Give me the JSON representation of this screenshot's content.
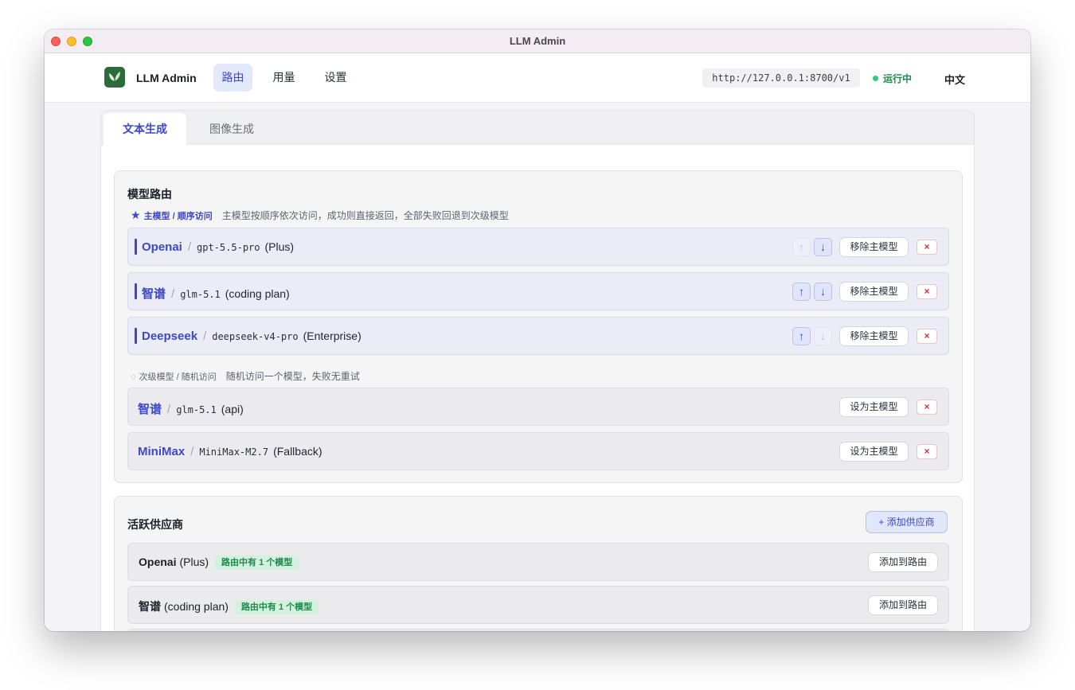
{
  "window": {
    "title": "LLM Admin"
  },
  "header": {
    "brand": "LLM Admin",
    "nav": [
      {
        "label": "路由",
        "active": true
      },
      {
        "label": "用量",
        "active": false
      },
      {
        "label": "设置",
        "active": false
      }
    ],
    "endpoint": "http://127.0.0.1:8700/v1",
    "status": "运行中",
    "language": "中文"
  },
  "tabs": [
    {
      "label": "文本生成",
      "active": true
    },
    {
      "label": "图像生成",
      "active": false
    }
  ],
  "routing": {
    "title": "模型路由",
    "primary_hint": {
      "tag": "主模型 / 顺序访问",
      "desc": "主模型按顺序依次访问，成功则直接返回，全部失败回退到次级模型"
    },
    "primary": [
      {
        "provider": "Openai",
        "model": "gpt-5.5-pro",
        "note": "(Plus)",
        "up_enabled": false,
        "down_enabled": true,
        "action": "移除主模型",
        "remove": "×"
      },
      {
        "provider": "智谱",
        "model": "glm-5.1",
        "note": "(coding plan)",
        "up_enabled": true,
        "down_enabled": true,
        "action": "移除主模型",
        "remove": "×"
      },
      {
        "provider": "Deepseek",
        "model": "deepseek-v4-pro",
        "note": "(Enterprise)",
        "up_enabled": true,
        "down_enabled": false,
        "action": "移除主模型",
        "remove": "×"
      }
    ],
    "secondary_hint": {
      "tag": "次级模型 / 随机访问",
      "desc": "随机访问一个模型，失败无重试"
    },
    "secondary": [
      {
        "provider": "智谱",
        "model": "glm-5.1",
        "note": "(api)",
        "action": "设为主模型",
        "remove": "×"
      },
      {
        "provider": "MiniMax",
        "model": "MiniMax-M2.7",
        "note": "(Fallback)",
        "action": "设为主模型",
        "remove": "×"
      }
    ]
  },
  "providers": {
    "title": "活跃供应商",
    "add_label": "+ 添加供应商",
    "items": [
      {
        "name": "Openai",
        "note": "(Plus)",
        "badge": "路由中有 1 个模型",
        "action": "添加到路由"
      },
      {
        "name": "智谱",
        "note": "(coding plan)",
        "badge": "路由中有 1 个模型",
        "action": "添加到路由"
      }
    ]
  },
  "icons": {
    "up": "arrow-up-icon",
    "down": "arrow-down-icon",
    "star": "star-icon",
    "secondary": "circle-icon",
    "logo": "leaf-icon"
  },
  "colors": {
    "accent": "#3b48c8",
    "status": "#1e8a4c",
    "danger": "#d8323a"
  }
}
